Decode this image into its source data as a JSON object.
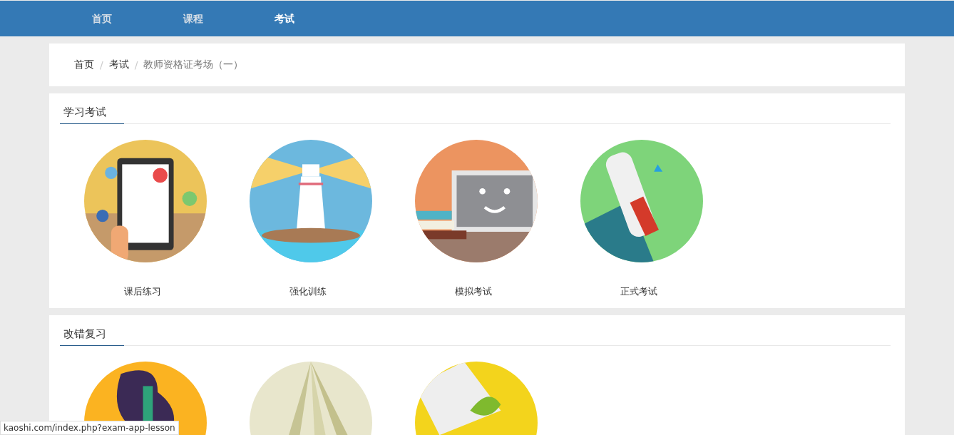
{
  "nav": {
    "items": [
      {
        "label": "首页",
        "selected": false
      },
      {
        "label": "课程",
        "selected": false
      },
      {
        "label": "考试",
        "selected": true
      }
    ]
  },
  "breadcrumb": {
    "separator": "/",
    "items": [
      "首页",
      "考试",
      "教师资格证考场（一）"
    ]
  },
  "sections": [
    {
      "title": "学习考试",
      "items": [
        {
          "kind": "tablet",
          "label": "课后练习"
        },
        {
          "kind": "lighthouse",
          "label": "强化训练"
        },
        {
          "kind": "monitor",
          "label": "模拟考试"
        },
        {
          "kind": "diploma",
          "label": "正式考试"
        }
      ]
    },
    {
      "title": "改错复习",
      "items": [
        {
          "kind": "abstract"
        },
        {
          "kind": "book"
        },
        {
          "kind": "envelope"
        }
      ]
    }
  ],
  "status_bar": "kaoshi.com/index.php?exam-app-lesson"
}
